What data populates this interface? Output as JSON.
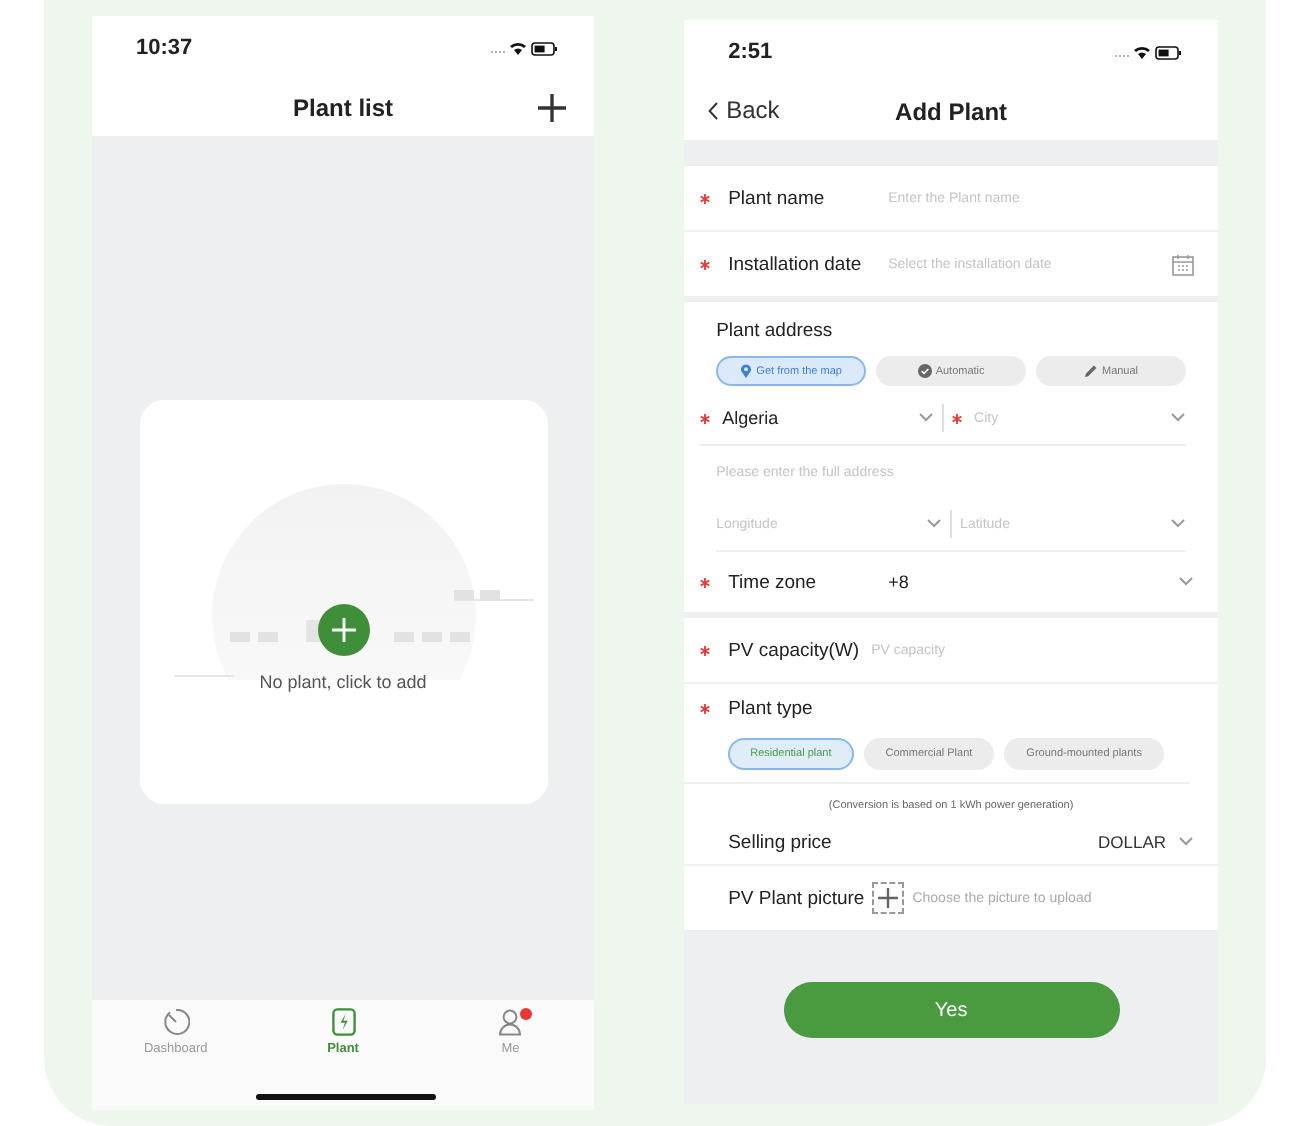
{
  "plant_list_screen": {
    "status_bar": {
      "time": "10:37"
    },
    "title": "Plant list",
    "empty_state": {
      "message": "No plant, click to add"
    },
    "tab_bar": [
      {
        "label": "Dashboard",
        "kind": "dashboard",
        "selected": false,
        "badge": false
      },
      {
        "label": "Plant",
        "kind": "plant",
        "selected": true,
        "badge": false
      },
      {
        "label": "Me",
        "kind": "me",
        "selected": false,
        "badge": true
      }
    ]
  },
  "add_plant_screen": {
    "status_bar": {
      "time": "2:51"
    },
    "back": "Back",
    "title": "Add Plant",
    "plant_name": {
      "label": "Plant name",
      "required": true,
      "placeholder": "Enter the Plant name"
    },
    "installation_date": {
      "label": "Installation date",
      "required": true,
      "placeholder": "Select the installation date"
    },
    "address": {
      "title": "Plant address",
      "methods": [
        {
          "label": "Get from the map",
          "kind": "map",
          "selected": true
        },
        {
          "label": "Automatic",
          "kind": "auto",
          "selected": false
        },
        {
          "label": "Manual",
          "kind": "manual",
          "selected": false
        }
      ],
      "country": {
        "value": "Algeria",
        "required": true
      },
      "city": {
        "placeholder": "City",
        "required": true
      },
      "full_address": {
        "placeholder": "Please enter the full address"
      },
      "longitude": {
        "placeholder": "Longitude"
      },
      "latitude": {
        "placeholder": "Latitude"
      }
    },
    "time_zone": {
      "label": "Time zone",
      "required": true,
      "value": "+8"
    },
    "pv_capacity": {
      "label": "PV capacity(W)",
      "required": true,
      "placeholder": "PV capacity"
    },
    "plant_type": {
      "label": "Plant type",
      "required": true,
      "options": [
        {
          "label": "Residential plant",
          "selected": true
        },
        {
          "label": "Commercial Plant",
          "selected": false
        },
        {
          "label": "Ground-mounted plants",
          "selected": false
        }
      ],
      "note": "(Conversion is based on 1 kWh power generation)"
    },
    "selling_price": {
      "label": "Selling price",
      "currency": "DOLLAR"
    },
    "picture": {
      "label": "PV Plant picture",
      "hint": "Choose the picture to upload"
    },
    "submit": "Yes"
  }
}
